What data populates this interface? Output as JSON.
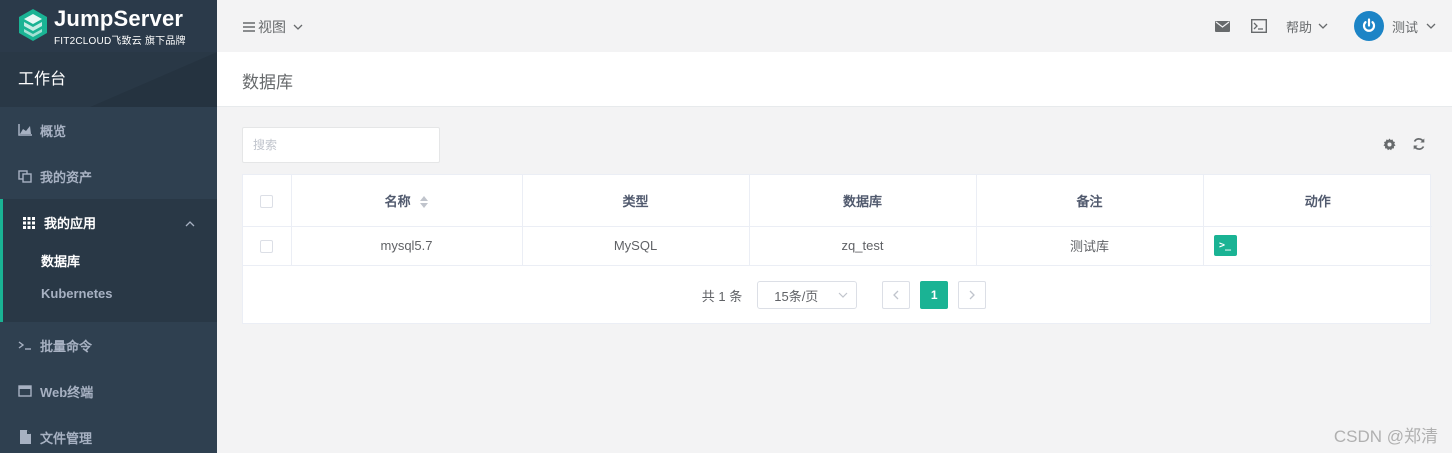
{
  "brand": {
    "title": "JumpServer",
    "subtitle": "FIT2CLOUD飞致云 旗下品牌"
  },
  "sidebar": {
    "workbench": "工作台",
    "items": [
      {
        "label": "概览",
        "icon": "area-chart-icon"
      },
      {
        "label": "我的资产",
        "icon": "assets-icon"
      },
      {
        "label": "我的应用",
        "icon": "grid-icon",
        "expanded": true,
        "children": [
          {
            "label": "数据库",
            "active": true
          },
          {
            "label": "Kubernetes",
            "active": false
          }
        ]
      },
      {
        "label": "批量命令",
        "icon": "terminal-prompt-icon"
      },
      {
        "label": "Web终端",
        "icon": "window-icon"
      },
      {
        "label": "文件管理",
        "icon": "file-icon"
      }
    ]
  },
  "topbar": {
    "view_label": "视图",
    "help_label": "帮助",
    "username": "测试",
    "icons": [
      "mail-icon",
      "terminal-icon"
    ]
  },
  "page": {
    "title": "数据库"
  },
  "search": {
    "placeholder": "搜索",
    "value": ""
  },
  "table": {
    "columns": [
      "名称",
      "类型",
      "数据库",
      "备注",
      "动作"
    ],
    "rows": [
      {
        "name": "mysql5.7",
        "type": "MySQL",
        "database": "zq_test",
        "comment": "测试库",
        "action_label": ">_"
      }
    ]
  },
  "pagination": {
    "total_label": "共 1 条",
    "page_size_label": "15条/页",
    "current_page": "1"
  },
  "watermark": "CSDN @郑清",
  "colors": {
    "accent": "#1ab394",
    "sidebar_bg": "#2f4050",
    "avatar": "#1c84c6"
  }
}
